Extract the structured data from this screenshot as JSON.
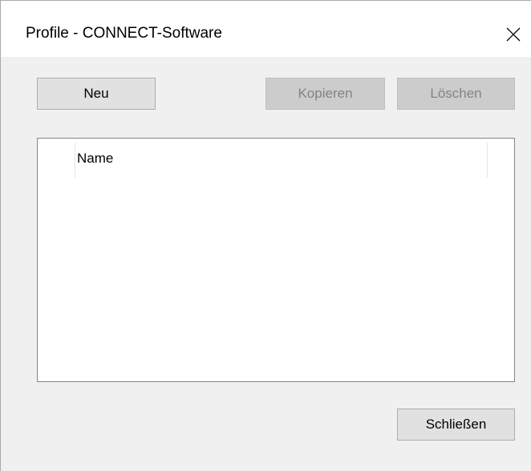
{
  "window": {
    "title": "Profile - CONNECT-Software"
  },
  "toolbar": {
    "new_label": "Neu",
    "copy_label": "Kopieren",
    "delete_label": "Löschen"
  },
  "list": {
    "columns": [
      "",
      "Name"
    ],
    "rows": []
  },
  "footer": {
    "close_label": "Schließen"
  },
  "icons": {
    "close": "close-icon"
  }
}
